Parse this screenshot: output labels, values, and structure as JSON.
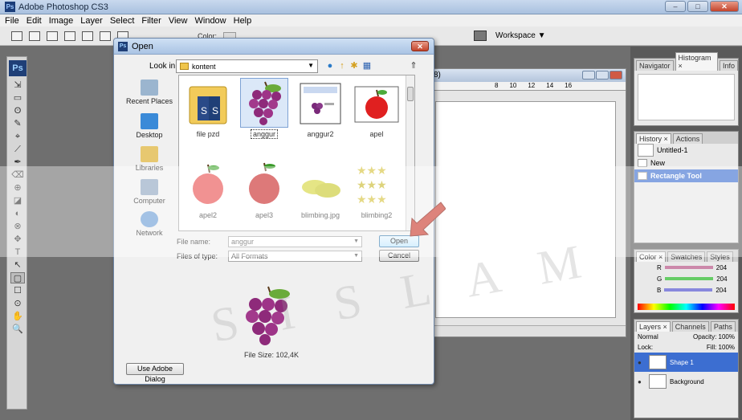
{
  "app": {
    "title": "Adobe Photoshop CS3",
    "badge": "Ps",
    "menu": [
      "File",
      "Edit",
      "Image",
      "Layer",
      "Select",
      "Filter",
      "View",
      "Window",
      "Help"
    ],
    "options_color_label": "Color:",
    "workspace_label": "Workspace ▼"
  },
  "tools": [
    "⇲",
    "▭",
    "ʘ",
    "✎",
    "⌖",
    "⟋",
    "✒",
    "⌫",
    "⊕",
    "◪",
    "◐",
    "⊗",
    "✥",
    "T",
    "↖",
    "▢",
    "☐",
    "⊙",
    "✋",
    "🔍"
  ],
  "document": {
    "title_fragment": "8)",
    "ruler": [
      "8",
      "10",
      "12",
      "14",
      "16"
    ]
  },
  "panels": {
    "navigator_tabs": [
      "Navigator",
      "Histogram ×",
      "Info"
    ],
    "history_tabs": [
      "History ×",
      "Actions"
    ],
    "history_rows": [
      "Untitled-1",
      "New",
      "Rectangle Tool"
    ],
    "color_tabs": [
      "Color ×",
      "Swatches",
      "Styles"
    ],
    "color_sliders": [
      {
        "label": "R",
        "value": "204",
        "color": "#cc88aa"
      },
      {
        "label": "G",
        "value": "204",
        "color": "#66cc66"
      },
      {
        "label": "B",
        "value": "204",
        "color": "#8888dd"
      }
    ],
    "layers_tabs": [
      "Layers ×",
      "Channels",
      "Paths"
    ],
    "blend_mode": "Normal",
    "opacity": "Opacity: 100%",
    "lock_label": "Lock:",
    "fill": "Fill: 100%",
    "layers": [
      "Shape 1",
      "Background"
    ]
  },
  "dialog": {
    "title": "Open",
    "badge": "Ps",
    "close_glyph": "✕",
    "look_in_label": "Look in:",
    "look_in_value": "kontent",
    "places": [
      "Recent Places",
      "Desktop",
      "Libraries",
      "Computer",
      "Network"
    ],
    "files": [
      {
        "name": "file pzd",
        "kind": "folder"
      },
      {
        "name": "anggur",
        "kind": "grape",
        "selected": true
      },
      {
        "name": "anggur2",
        "kind": "doc"
      },
      {
        "name": "apel",
        "kind": "apple-frame"
      },
      {
        "name": "apel2",
        "kind": "apple-light"
      },
      {
        "name": "apel3",
        "kind": "apple-dark"
      },
      {
        "name": "blimbing.jpg",
        "kind": "starfruit"
      },
      {
        "name": "blimbing2",
        "kind": "stars"
      }
    ],
    "file_name_label": "File name:",
    "file_name_value": "anggur",
    "files_of_type_label": "Files of type:",
    "files_of_type_value": "All Formats",
    "open_button": "Open",
    "cancel_button": "Cancel",
    "file_size": "File Size: 102,4K",
    "adobe_dialog_button": "Use Adobe Dialog"
  },
  "watermark": "S I S L A M"
}
